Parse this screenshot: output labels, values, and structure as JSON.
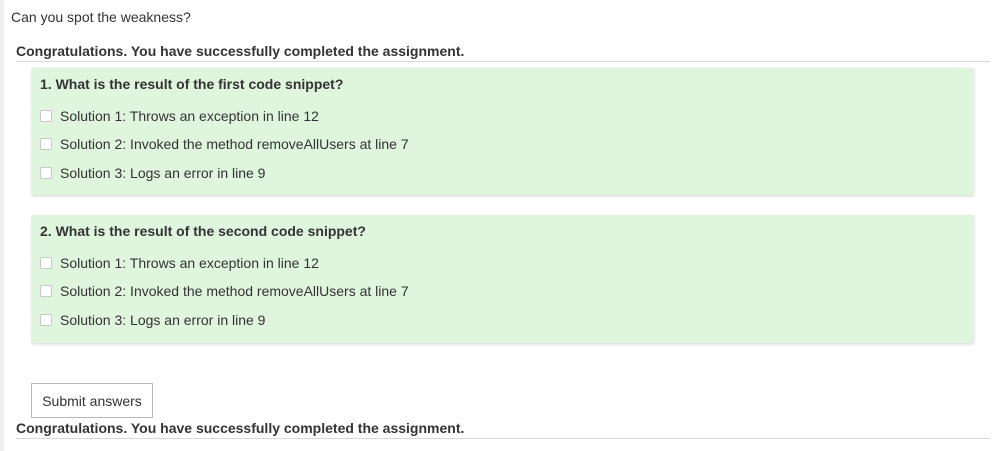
{
  "prompt": "Can you spot the weakness?",
  "feedback_top": "Congratulations. You have successfully completed the assignment.",
  "questions": [
    {
      "title": "1. What is the result of the first code snippet?",
      "options": [
        "Solution 1: Throws an exception in line 12",
        "Solution 2: Invoked the method removeAllUsers at line 7",
        "Solution 3: Logs an error in line 9"
      ]
    },
    {
      "title": "2. What is the result of the second code snippet?",
      "options": [
        "Solution 1: Throws an exception in line 12",
        "Solution 2: Invoked the method removeAllUsers at line 7",
        "Solution 3: Logs an error in line 9"
      ]
    }
  ],
  "submit_label": "Submit answers",
  "feedback_bottom": "Congratulations. You have successfully completed the assignment.",
  "colors": {
    "question_background": "#dff5dd",
    "text": "#333333"
  }
}
